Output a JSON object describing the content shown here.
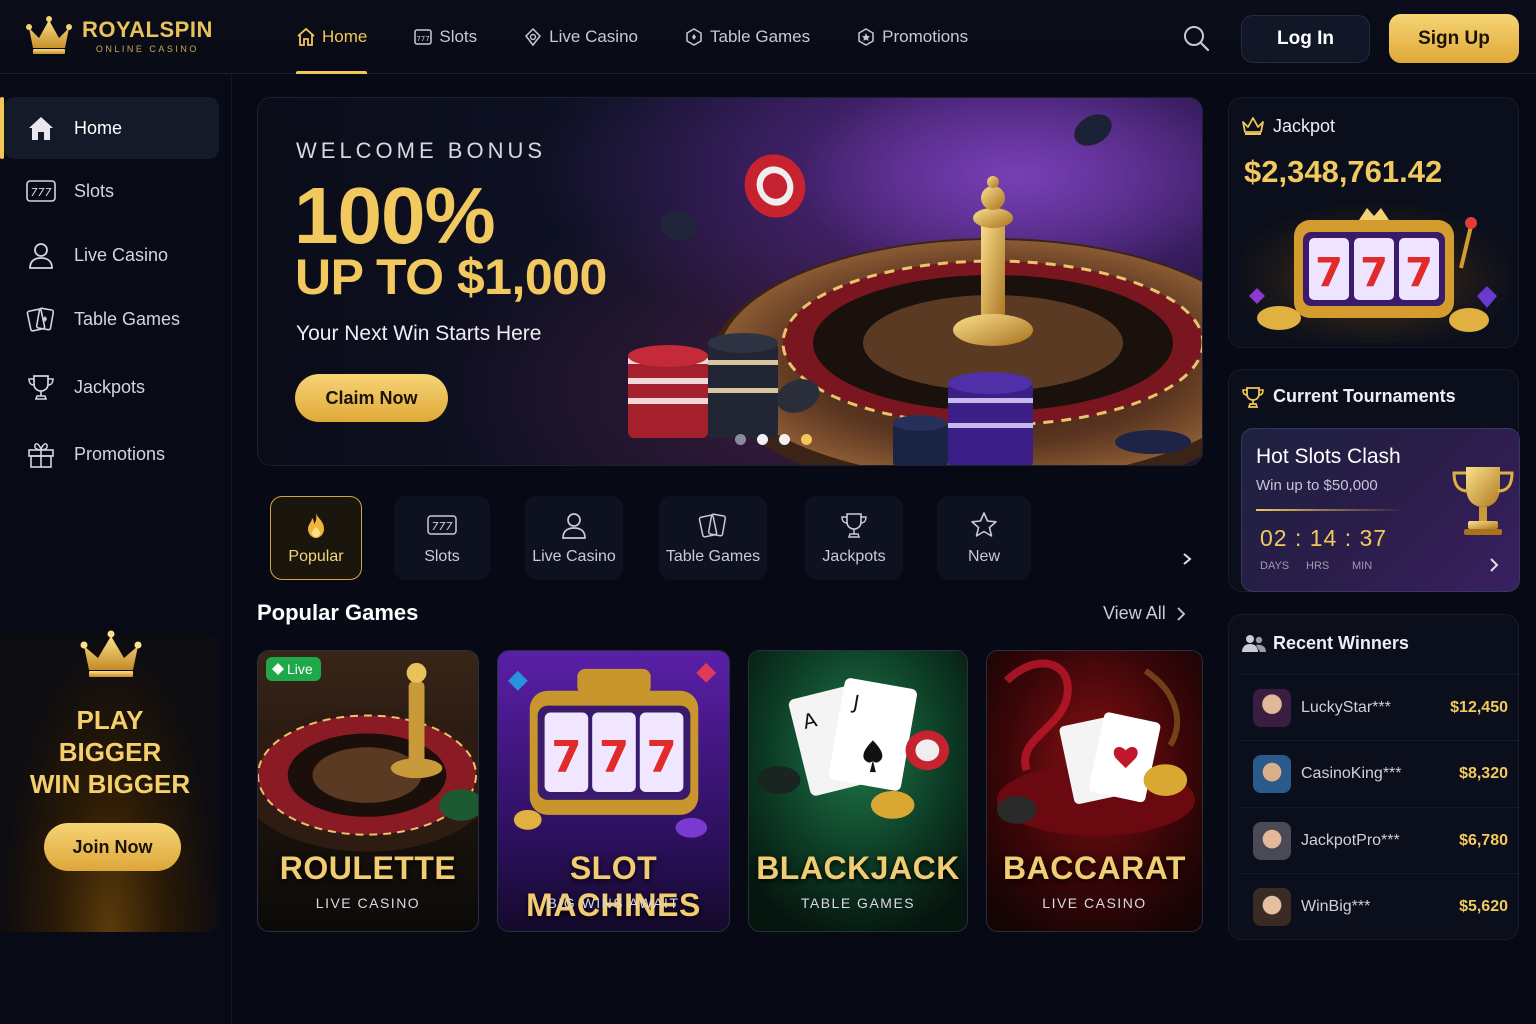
{
  "brand": {
    "name": "ROYALSPIN",
    "tagline": "ONLINE CASINO"
  },
  "topnav": {
    "items": [
      {
        "label": "Home",
        "icon": "home-icon",
        "active": true
      },
      {
        "label": "Slots",
        "icon": "slots-icon"
      },
      {
        "label": "Live Casino",
        "icon": "live-casino-icon"
      },
      {
        "label": "Table Games",
        "icon": "table-games-icon"
      },
      {
        "label": "Promotions",
        "icon": "promotions-icon"
      }
    ],
    "login": "Log In",
    "signup": "Sign Up"
  },
  "sidebar": {
    "items": [
      {
        "label": "Home",
        "icon": "home-icon",
        "active": true
      },
      {
        "label": "Slots",
        "icon": "slots-777-icon"
      },
      {
        "label": "Live Casino",
        "icon": "user-icon"
      },
      {
        "label": "Table Games",
        "icon": "cards-icon"
      },
      {
        "label": "Jackpots",
        "icon": "trophy-icon"
      },
      {
        "label": "Promotions",
        "icon": "gift-icon"
      }
    ],
    "promo": {
      "title": "PLAY\nBIGGER\nWIN BIGGER",
      "button": "Join Now"
    }
  },
  "hero": {
    "eyebrow": "WELCOME BONUS",
    "headline": "100%",
    "subheadline": "UP TO $1,000",
    "tagline": "Your Next Win Starts Here",
    "button": "Claim Now",
    "slides": 4,
    "active_slide": 4
  },
  "categories": [
    {
      "label": "Popular",
      "icon": "flame-icon",
      "active": true
    },
    {
      "label": "Slots",
      "icon": "slots-777-icon"
    },
    {
      "label": "Live Casino",
      "icon": "user-icon"
    },
    {
      "label": "Table Games",
      "icon": "cards-icon"
    },
    {
      "label": "Jackpots",
      "icon": "trophy-icon"
    },
    {
      "label": "New",
      "icon": "star-icon"
    }
  ],
  "popular": {
    "title": "Popular Games",
    "view_all": "View All",
    "games": [
      {
        "title": "ROULETTE",
        "subtitle": "LIVE CASINO",
        "badge": "Live"
      },
      {
        "title": "SLOT MACHINES",
        "subtitle": "BIG WINS AWAIT"
      },
      {
        "title": "BLACKJACK",
        "subtitle": "TABLE GAMES"
      },
      {
        "title": "BACCARAT",
        "subtitle": "LIVE CASINO"
      }
    ]
  },
  "jackpot": {
    "label": "Jackpot",
    "amount": "$2,348,761.42"
  },
  "tournaments": {
    "title": "Current Tournaments",
    "card": {
      "name": "Hot Slots Clash",
      "prize": "Win up to $50,000",
      "countdown": "02 : 14 : 37",
      "units": [
        "DAYS",
        "HRS",
        "MIN"
      ]
    }
  },
  "winners": {
    "title": "Recent Winners",
    "rows": [
      {
        "name": "LuckyStar***",
        "amount": "$12,450"
      },
      {
        "name": "CasinoKing***",
        "amount": "$8,320"
      },
      {
        "name": "JackpotPro***",
        "amount": "$6,780"
      },
      {
        "name": "WinBig***",
        "amount": "$5,620"
      }
    ]
  },
  "colors": {
    "gold": "#f2c95e",
    "background": "#070a14",
    "live_green": "#1fa84a"
  }
}
